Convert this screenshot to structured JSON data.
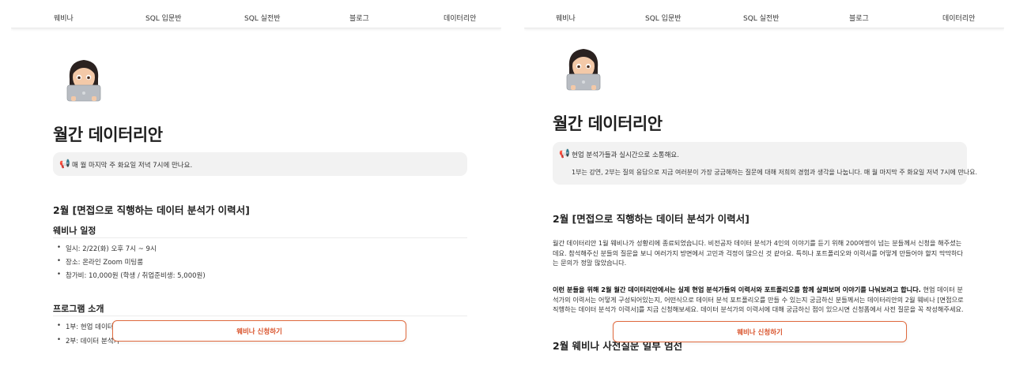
{
  "nav": {
    "items": [
      "웨비나",
      "SQL 입문반",
      "SQL 실전반",
      "블로그",
      "데이터리안"
    ]
  },
  "icons": {
    "avatar": "memoji-woman-laptop-icon",
    "megaphone": "megaphone-icon"
  },
  "colors": {
    "accent": "#e06a3e",
    "callout_bg": "#f2f2f2"
  },
  "left": {
    "title": "월간 데이터리안",
    "callout_text": "매 월 마지막 주 화요일 저녁 7시에 만나요.",
    "section_title": "2월 [면접으로 직행하는 데이터 분석가 이력서]",
    "schedule_heading": "웨비나 일정",
    "schedule_items": [
      "일시: 2/22(화) 오후 7시 ~ 9시",
      "장소: 온라인 Zoom 미팅룸",
      "참가비: 10,000원 (학생 / 취업준비생: 5,000원)"
    ],
    "program_heading": "프로그램 소개",
    "program_items": [
      "1부: 현업 데이터 분",
      "2부: 데이터 분석가"
    ],
    "cta": "웨비나 신청하기"
  },
  "right": {
    "title": "월간 데이터리안",
    "callout_line1": "현업 분석가들과 실시간으로 소통해요.",
    "callout_line2": "1부는 강연, 2부는 질의 응답으로 지금 여러분이 가장 궁금해하는 질문에 대해 저희의 경험과 생각을 나눕니다. 매 월 마지막 주 화요일 저녁 7시에 만나요.",
    "section_title": "2월 [면접으로 직행하는 데이터 분석가 이력서]",
    "para1": "월간 데이터리안 1월 웨비나가 성황리에 종료되었습니다. 비전공자 데이터 분석가 4인의 이야기를 듣기 위해 200여명이 넘는 분들께서 신청을 해주셨는데요. 참석해주신 분들의 질문을 보니 여러가지 방면에서 고민과 걱정이 많으신 것 같아요. 특히나 포트폴리오와 이력서를 어떻게 만들어야 할지 막막하다는 문의가 정말 많았습니다.",
    "para2_bold": "이런 분들을 위해 2월 월간 데이터리안에서는 실제 현업 분석가들의 이력서와 포트폴리오를 함께 살펴보며 이야기를 나눠보려고 합니다.",
    "para2_rest": " 현업 데이터 분석가의 이력서는 어떻게 구성되어있는지, 어떤식으로 데이터 분석 포트폴리오를 만들 수 있는지 궁금하신 분들께서는 데이터리안의 2월 웨비나 [면접으로 직행하는 데이터 분석가 이력서]를 지금 신청해보세요. 데이터 분석가의 이력서에 대해 궁금하신 점이 있으시면 신청폼에서 사전 질문을 꼭 작성해주세요.",
    "next_heading": "2월 웨비나 사전질문 일부 엄선",
    "cta": "웨비나 신청하기"
  }
}
